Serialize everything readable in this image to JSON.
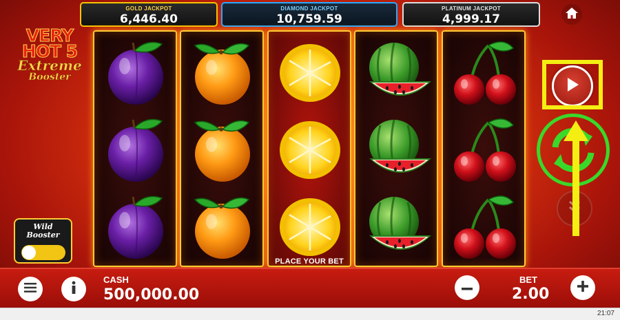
{
  "jackpots": {
    "gold": {
      "label": "GOLD JACKPOT",
      "value": "6,446.40"
    },
    "diamond": {
      "label": "DIAMOND JACKPOT",
      "value": "10,759.59"
    },
    "platinum": {
      "label": "PLATINUM JACKPOT",
      "value": "4,999.17"
    }
  },
  "logo": {
    "line1a": "VERY",
    "line1b": "HOT 5",
    "line2": "Extreme",
    "line3": "Booster"
  },
  "reels": [
    [
      "plum",
      "plum",
      "plum"
    ],
    [
      "orange",
      "orange",
      "orange"
    ],
    [
      "lemon",
      "lemon",
      "lemon"
    ],
    [
      "watermelon",
      "watermelon",
      "watermelon"
    ],
    [
      "cherry",
      "cherry",
      "cherry"
    ]
  ],
  "wild_booster": {
    "line1": "Wild",
    "line2": "Booster",
    "enabled": false
  },
  "message": "PLACE YOUR BET",
  "bottom_bar": {
    "cash_label": "CASH",
    "cash_value": "500,000.00",
    "bet_label": "BET",
    "bet_value": "2.00"
  },
  "clock": "21:07",
  "icons": {
    "home": "home-icon",
    "play": "play-icon",
    "autoplay": "autoplay-icon",
    "turbo": "turbo-icon",
    "menu": "menu-icon",
    "info": "info-icon",
    "minus": "minus-icon",
    "plus": "plus-icon"
  },
  "colors": {
    "highlight": "#f4ee13",
    "autoplay_ring": "#3ad829",
    "bar": "#c81c10"
  }
}
